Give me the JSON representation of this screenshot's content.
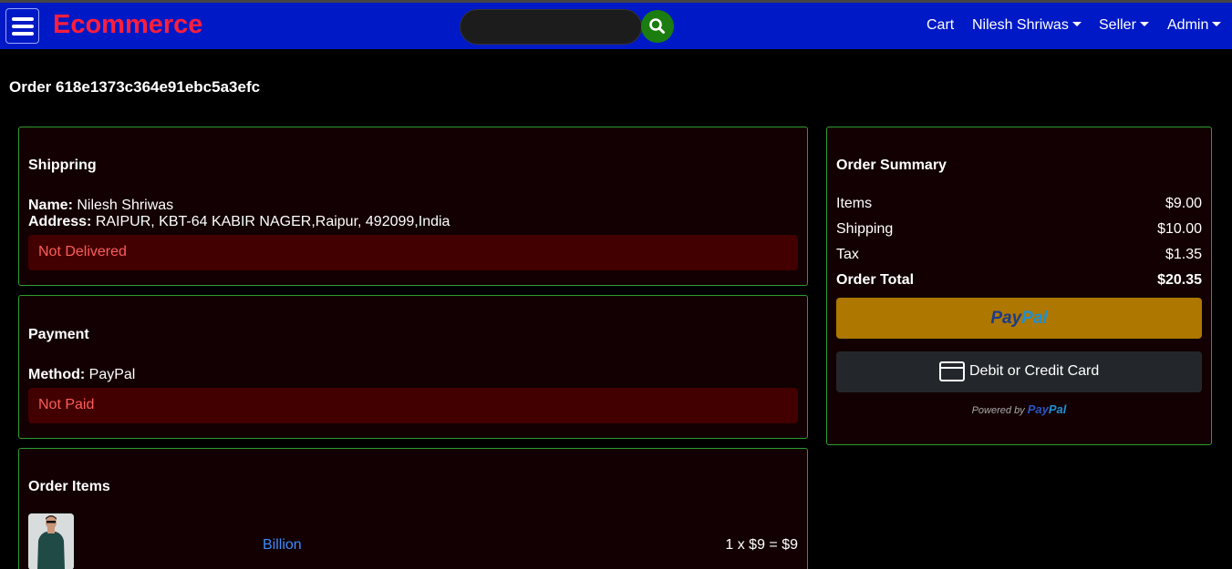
{
  "header": {
    "brand": "Ecommerce",
    "search": {
      "placeholder": "",
      "value": ""
    },
    "nav": {
      "cart": "Cart",
      "user": "Nilesh Shriwas",
      "seller": "Seller",
      "admin": "Admin"
    },
    "colors": {
      "bar": "#0019c6",
      "brand": "#ff1e3c",
      "search_button": "#1b7d10"
    }
  },
  "page": {
    "title": "Order 618e1373c364e91ebc5a3efc"
  },
  "shipping": {
    "title": "Shippring",
    "name_label": "Name:",
    "name": "Nilesh Shriwas",
    "address_label": "Address:",
    "address": "RAIPUR, KBT-64 KABIR NAGER,Raipur, 492099,India",
    "status": "Not Delivered"
  },
  "payment": {
    "title": "Payment",
    "method_label": "Method:",
    "method": "PayPal",
    "status": "Not Paid"
  },
  "order_items": {
    "title": "Order Items",
    "items": [
      {
        "name": "Billion",
        "quantity_price": "1 x $9 = $9",
        "image_icon": "product-thumbnail"
      }
    ]
  },
  "summary": {
    "title": "Order Summary",
    "rows": [
      {
        "label": "Items",
        "value": "$9.00"
      },
      {
        "label": "Shipping",
        "value": "$10.00"
      },
      {
        "label": "Tax",
        "value": "$1.35"
      },
      {
        "label": "Order Total",
        "value": "$20.35"
      }
    ],
    "paypal_button": {
      "part1": "Pay",
      "part2": "Pal"
    },
    "card_button": "Debit or Credit Card",
    "powered_by": {
      "prefix": "Powered by",
      "part1": "Pay",
      "part2": "Pal"
    }
  }
}
